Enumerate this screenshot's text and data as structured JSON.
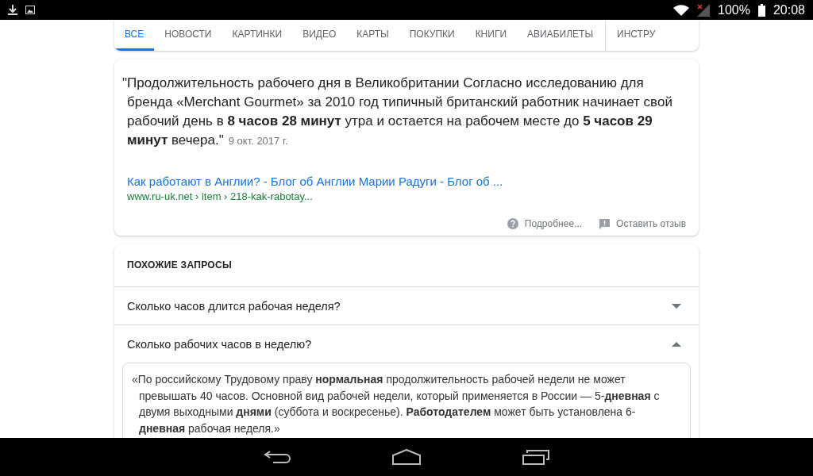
{
  "status_bar": {
    "battery": "100%",
    "time": "20:08"
  },
  "tabs": [
    {
      "label": "ВСЕ",
      "selected": true
    },
    {
      "label": "НОВОСТИ",
      "selected": false
    },
    {
      "label": "КАРТИНКИ",
      "selected": false
    },
    {
      "label": "ВИДЕО",
      "selected": false
    },
    {
      "label": "КАРТЫ",
      "selected": false
    },
    {
      "label": "ПОКУПКИ",
      "selected": false
    },
    {
      "label": "КНИГИ",
      "selected": false
    },
    {
      "label": "АВИАБИЛЕТЫ",
      "selected": false
    },
    {
      "label": "ИНСТРУ",
      "selected": false
    }
  ],
  "featured_snippet": {
    "text": "\"Продолжительность рабочего дня в Великобритании Согласно исследованию для бренда «Merchant Gourmet» за 2010 год типичный британский работник начинает свой рабочий день в **8 часов 28 минут** утра и остается на рабочем месте до **5 часов 29 минут** вечера.\"",
    "date": "9 окт. 2017 г.",
    "link_title": "Как работают в Англии? - Блог об Англии Марии Радуги - Блог об ...",
    "url": "www.ru-uk.net › item › 218-kak-rabotay...",
    "actions": [
      {
        "kind": "help",
        "label": "Подробнее..."
      },
      {
        "kind": "feedback",
        "label": "Оставить отзыв"
      }
    ]
  },
  "related": {
    "title": "ПОХОЖИЕ ЗАПРОСЫ",
    "questions": [
      {
        "text": "Сколько часов длится рабочая неделя?",
        "expanded": false
      },
      {
        "text": "Сколько рабочих часов в неделю?",
        "expanded": true,
        "answer": "«По российскому Трудовому праву **нормальная** продолжительность рабочей недели не может превышать 40 часов. Основной вид рабочей недели, который применяется в России — 5-**дневная** с двумя выходными **днями** (суббота и воскресенье). **Работодателем** может быть установлена 6-**дневная** рабочая неделя.»"
      }
    ]
  }
}
